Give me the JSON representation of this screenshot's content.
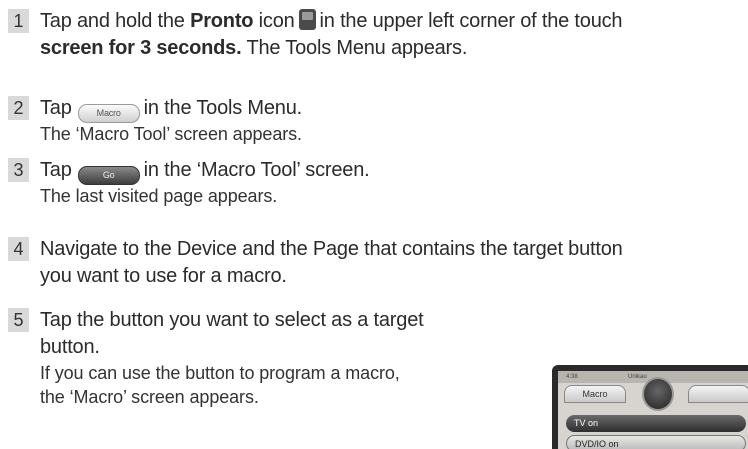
{
  "steps": [
    {
      "number": "1",
      "line1_pre": "Tap and hold the ",
      "line1_bold": "Pronto",
      "line1_mid": " icon",
      "line1_post": "in the upper left corner of the touch",
      "line2_text": "screen for 3 seconds.",
      "line2_plain": " The Tools Menu appears."
    },
    {
      "number": "2",
      "line1_pre": "Tap",
      "button_label": "Macro",
      "line1_post": "in the Tools Menu.",
      "sub": "The ‘Macro Tool’ screen appears."
    },
    {
      "number": "3",
      "line1_pre": "Tap",
      "button_label": "Go",
      "line1_post": "in the ‘Macro Tool’ screen.",
      "sub": "The last visited page appears."
    },
    {
      "number": "4",
      "line1": "Navigate to the Device and the Page that contains the target button",
      "line2": "you want to use for a macro."
    },
    {
      "number": "5",
      "line1": "Tap the button you want to select as a target",
      "line2": "button.",
      "sub1": "If you can use the button to program a macro,",
      "sub2": "the ‘Macro’ screen appears."
    }
  ],
  "device_screen": {
    "time": "4:38",
    "title": "Unikau",
    "tab_label": "Macro",
    "rows": [
      "TV on",
      "DVD/IO on"
    ]
  }
}
